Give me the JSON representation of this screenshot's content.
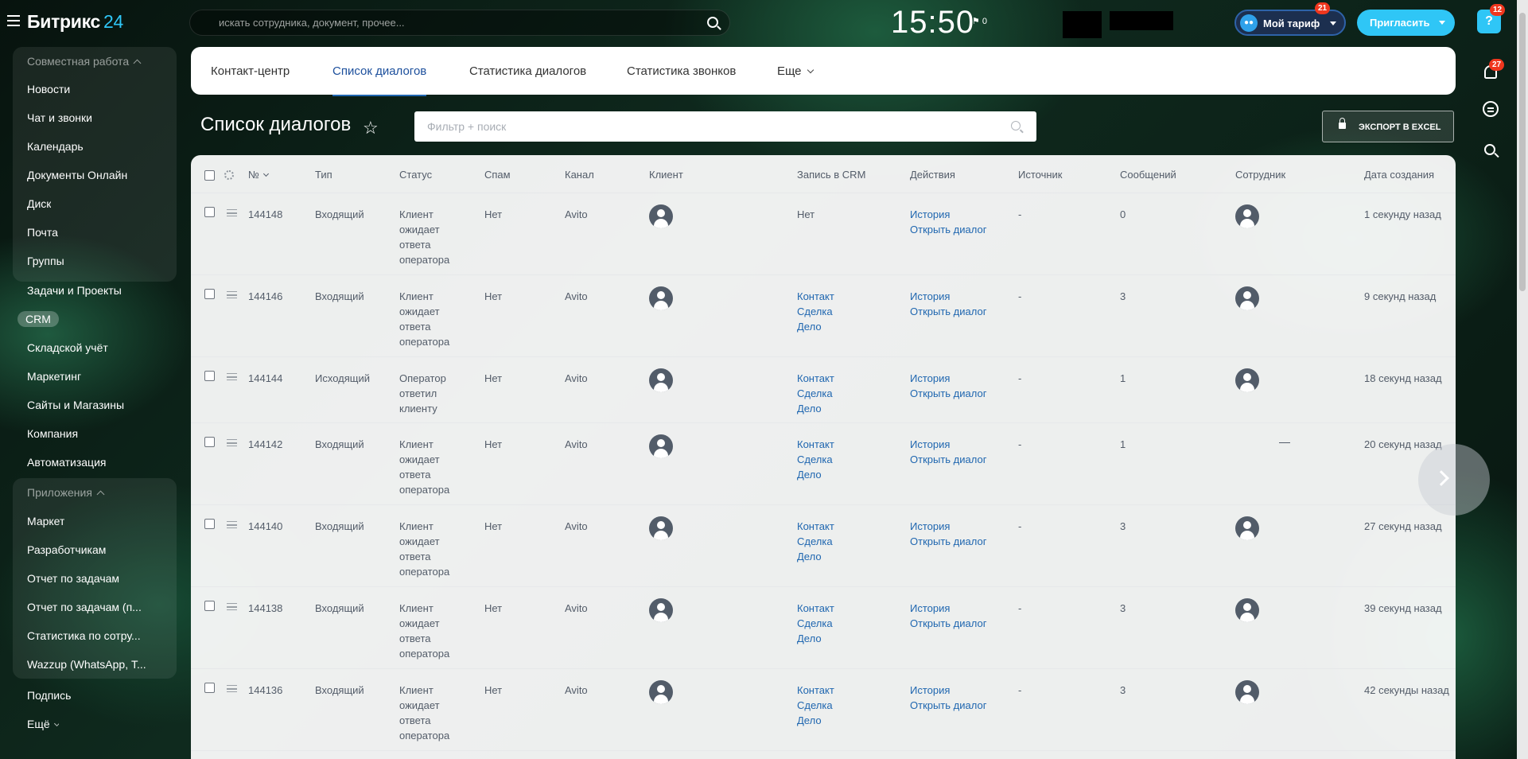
{
  "header": {
    "logo_text": "Битрикс",
    "logo_num": "24",
    "search_placeholder": "искать сотрудника, документ, прочее...",
    "clock": "15:50",
    "flag_count": "0",
    "tariff_label": "Мой тариф",
    "tariff_badge": "21",
    "invite_label": "Пригласить"
  },
  "sidebar": {
    "group1_title": "Совместная работа",
    "items": [
      {
        "label": "Новости"
      },
      {
        "label": "Чат и звонки"
      },
      {
        "label": "Календарь"
      },
      {
        "label": "Документы Онлайн"
      },
      {
        "label": "Диск"
      },
      {
        "label": "Почта"
      },
      {
        "label": "Группы"
      },
      {
        "label": "Задачи и Проекты"
      },
      {
        "label": "CRM"
      },
      {
        "label": "Складской учёт"
      },
      {
        "label": "Маркетинг"
      },
      {
        "label": "Сайты и Магазины"
      },
      {
        "label": "Компания"
      },
      {
        "label": "Автоматизация"
      }
    ],
    "group2_title": "Приложения",
    "apps": [
      {
        "label": "Маркет"
      },
      {
        "label": "Разработчикам"
      },
      {
        "label": "Отчет по задачам"
      },
      {
        "label": "Отчет по задачам (п..."
      },
      {
        "label": "Статистика по сотру..."
      },
      {
        "label": "Wazzup (WhatsApp, Т..."
      }
    ],
    "footer_items": [
      {
        "label": "Подпись"
      },
      {
        "label": "Ещё"
      }
    ]
  },
  "right_panel": {
    "help_label": "?",
    "help_badge": "12",
    "bell_badge": "27"
  },
  "tabs": [
    {
      "label": "Контакт-центр"
    },
    {
      "label": "Список диалогов"
    },
    {
      "label": "Статистика диалогов"
    },
    {
      "label": "Статистика звонков"
    },
    {
      "label": "Еще"
    }
  ],
  "page": {
    "title": "Список диалогов",
    "filter_placeholder": "Фильтр + поиск",
    "export_label": "ЭКСПОРТ В EXCEL"
  },
  "grid": {
    "columns": [
      "№",
      "Тип",
      "Статус",
      "Спам",
      "Канал",
      "Клиент",
      "Запись в CRM",
      "Действия",
      "Источник",
      "Сообщений",
      "Сотрудник",
      "Дата создания"
    ],
    "rows": [
      {
        "id": "144148",
        "type": "Входящий",
        "status": "Клиент ожидает ответа оператора",
        "spam": "Нет",
        "channel": "Avito",
        "crm": [
          "Нет"
        ],
        "actions": [
          "История",
          "Открыть диалог"
        ],
        "source": "-",
        "messages": "0",
        "employee": "avatar",
        "created": "1 секунду назад"
      },
      {
        "id": "144146",
        "type": "Входящий",
        "status": "Клиент ожидает ответа оператора",
        "spam": "Нет",
        "channel": "Avito",
        "crm": [
          "Контакт",
          "Сделка",
          "Дело"
        ],
        "actions": [
          "История",
          "Открыть диалог"
        ],
        "source": "-",
        "messages": "3",
        "employee": "avatar",
        "created": "9 секунд назад"
      },
      {
        "id": "144144",
        "type": "Исходящий",
        "status": "Оператор ответил клиенту",
        "spam": "Нет",
        "channel": "Avito",
        "crm": [
          "Контакт",
          "Сделка",
          "Дело"
        ],
        "actions": [
          "История",
          "Открыть диалог"
        ],
        "source": "-",
        "messages": "1",
        "employee": "avatar",
        "created": "18 секунд назад"
      },
      {
        "id": "144142",
        "type": "Входящий",
        "status": "Клиент ожидает ответа оператора",
        "spam": "Нет",
        "channel": "Avito",
        "crm": [
          "Контакт",
          "Сделка",
          "Дело"
        ],
        "actions": [
          "История",
          "Открыть диалог"
        ],
        "source": "-",
        "messages": "1",
        "employee": "none",
        "created": "20 секунд назад"
      },
      {
        "id": "144140",
        "type": "Входящий",
        "status": "Клиент ожидает ответа оператора",
        "spam": "Нет",
        "channel": "Avito",
        "crm": [
          "Контакт",
          "Сделка",
          "Дело"
        ],
        "actions": [
          "История",
          "Открыть диалог"
        ],
        "source": "-",
        "messages": "3",
        "employee": "avatar",
        "created": "27 секунд назад"
      },
      {
        "id": "144138",
        "type": "Входящий",
        "status": "Клиент ожидает ответа оператора",
        "spam": "Нет",
        "channel": "Avito",
        "crm": [
          "Контакт",
          "Сделка",
          "Дело"
        ],
        "actions": [
          "История",
          "Открыть диалог"
        ],
        "source": "-",
        "messages": "3",
        "employee": "avatar",
        "created": "39 секунд назад"
      },
      {
        "id": "144136",
        "type": "Входящий",
        "status": "Клиент ожидает ответа оператора",
        "spam": "Нет",
        "channel": "Avito",
        "crm": [
          "Контакт",
          "Сделка",
          "Дело"
        ],
        "actions": [
          "История",
          "Открыть диалог"
        ],
        "source": "-",
        "messages": "3",
        "employee": "avatar",
        "created": "42 секунды назад"
      }
    ]
  },
  "colors": {
    "accent": "#2fc6f6",
    "link": "#2067b0",
    "tab_active": "#1c4f9c",
    "badge": "#f0371e"
  }
}
